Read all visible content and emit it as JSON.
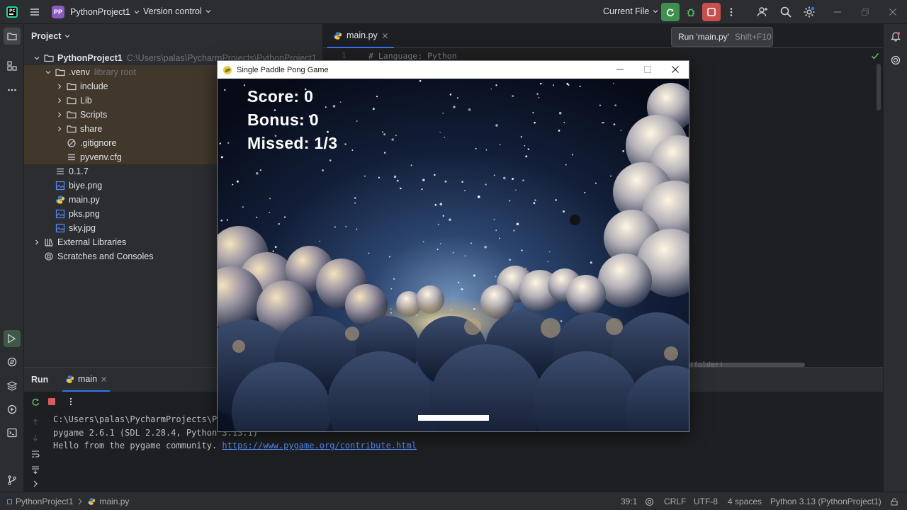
{
  "titlebar": {
    "project_badge": "PP",
    "project_name": "PythonProject1",
    "vcs_label": "Version control",
    "run_config": "Current File",
    "icons": [
      "menu-icon",
      "run-icon",
      "debug-icon",
      "stop-icon",
      "more-icon",
      "add-user-icon",
      "search-icon",
      "settings-icon"
    ]
  },
  "tooltip": {
    "text": "Run 'main.py'",
    "shortcut": "Shift+F10"
  },
  "project_panel": {
    "title": "Project",
    "rows": [
      {
        "label": "PythonProject1",
        "extra": "C:\\Users\\palas\\PycharmProjects\\PythonProject1"
      },
      {
        "label": ".venv",
        "extra": "library root"
      },
      {
        "label": "include"
      },
      {
        "label": "Lib"
      },
      {
        "label": "Scripts"
      },
      {
        "label": "share"
      },
      {
        "label": ".gitignore"
      },
      {
        "label": "pyvenv.cfg"
      },
      {
        "label": "0.1.7"
      },
      {
        "label": "biye.png"
      },
      {
        "label": "main.py"
      },
      {
        "label": "pks.png"
      },
      {
        "label": "sky.jpg"
      },
      {
        "label": "External Libraries"
      },
      {
        "label": "Scratches and Consoles"
      }
    ]
  },
  "editor": {
    "tab_label": "main.py",
    "line_number": "1",
    "line1": "# Language: Python",
    "partial_text": "(folder)"
  },
  "run_panel": {
    "title": "Run",
    "tab_label": "main",
    "console": [
      "C:\\Users\\palas\\PycharmProjects\\Pyth",
      "pygame 2.6.1 (SDL 2.28.4, Python 3.13.1)",
      "Hello from the pygame community. "
    ],
    "link": "https://www.pygame.org/contribute.html"
  },
  "statusbar": {
    "breadcrumb_project": "PythonProject1",
    "breadcrumb_file": "main.py",
    "position": "39:1",
    "line_sep": "CRLF",
    "encoding": "UTF-8",
    "indent": "4 spaces",
    "interpreter": "Python 3.13 (PythonProject1)"
  },
  "game": {
    "window_title": "Single Paddle Pong Game",
    "score_text": "Score: 0",
    "bonus_text": "Bonus: 0",
    "missed_text": "Missed: 1/3"
  }
}
